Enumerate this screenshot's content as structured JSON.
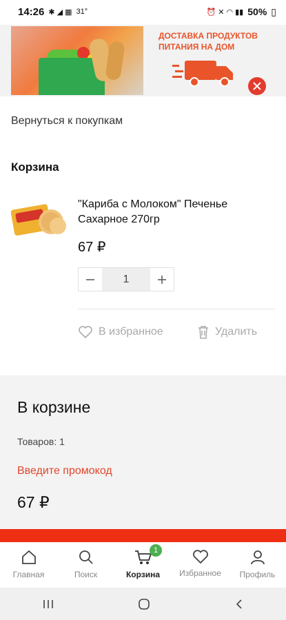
{
  "status_bar": {
    "time": "14:26",
    "temp": "31°",
    "battery": "50%"
  },
  "banner": {
    "title": "ДОСТАВКА ПРОДУКТОВ ПИТАНИЯ НА ДОМ"
  },
  "back_link": "Вернуться к покупкам",
  "cart": {
    "heading": "Корзина",
    "items": [
      {
        "name": "\"Кариба с Молоком\" Печенье Сахарное 270гр",
        "price": "67 ₽",
        "quantity": "1",
        "favorite_label": "В избранное",
        "delete_label": "Удалить"
      }
    ]
  },
  "summary": {
    "title": "В корзине",
    "count": "Товаров: 1",
    "promo": "Введите промокод",
    "total": "67 ₽"
  },
  "nav": [
    {
      "label": "Главная",
      "icon": "home-icon"
    },
    {
      "label": "Поиск",
      "icon": "search-icon"
    },
    {
      "label": "Корзина",
      "icon": "cart-icon",
      "badge": "1",
      "active": true
    },
    {
      "label": "Избранное",
      "icon": "heart-icon"
    },
    {
      "label": "Профиль",
      "icon": "profile-icon"
    }
  ],
  "colors": {
    "accent": "#e2452b",
    "checkout": "#ef2f14",
    "badge": "#4caf50"
  }
}
